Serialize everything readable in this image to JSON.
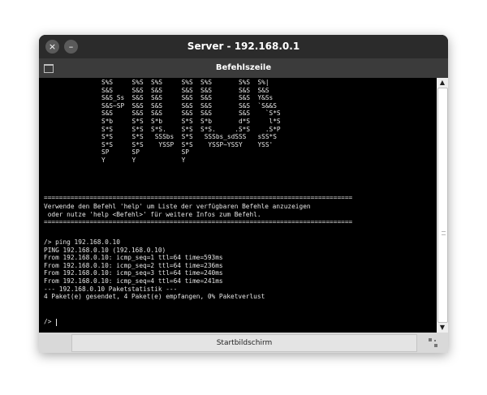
{
  "window": {
    "title": "Server - 192.168.0.1",
    "close_glyph": "×",
    "minimize_glyph": "–"
  },
  "panel": {
    "title": "Befehlszeile",
    "icon": "terminal-window-icon"
  },
  "terminal": {
    "banner": "S%S     S%S  S%S     S%S  S%S       S%S  S%|\nS&S     S&S  S&S     S&S  S&S       S&S  S&S\nS&S_Ss  S&S  S&S     S&S  S&S       S&S  Y&Ss\nS&S~SP  S&S  S&S     S&S  S&S       S&S  `S&&S\nS&S     S&S  S&S     S&S  S&S       S&S    `S*S\nS*b     S*S  S*b     S*S  S*b       d*S     l*S\nS*S     S*S  S*S.    S*S  S*S.     .S*S    .S*P\nS*S     S*S   SSSbs  S*S   SSSbs_sdSSS   sSS*S\nS*S     S*S    YSSP  S*S    YSSP~YSSY    YSS'\nSP      SP           SP\nY       Y            Y",
    "separator": "=================================================================================",
    "help_lines": [
      "Verwende den Befehl 'help' um Liste der verfügbaren Befehle anzuzeigen",
      " oder nutze 'help <Befehl>' für weitere Infos zum Befehl."
    ],
    "output_lines": [
      "/> ping 192.168.0.10",
      "PING 192.168.0.10 (192.168.0.10)",
      "From 192.168.0.10: icmp_seq=1 ttl=64 time=593ms",
      "From 192.168.0.10: icmp_seq=2 ttl=64 time=236ms",
      "From 192.168.0.10: icmp_seq=3 ttl=64 time=240ms",
      "From 192.168.0.10: icmp_seq=4 ttl=64 time=241ms",
      "--- 192.168.0.10 Paketstatistik ---",
      "4 Paket(e) gesendet, 4 Paket(e) empfangen, 0% Paketverlust"
    ],
    "prompt": "/>"
  },
  "scrollbar": {
    "up_glyph": "▲",
    "down_glyph": "▼"
  },
  "bottom": {
    "home_button": "Startbildschirm"
  }
}
